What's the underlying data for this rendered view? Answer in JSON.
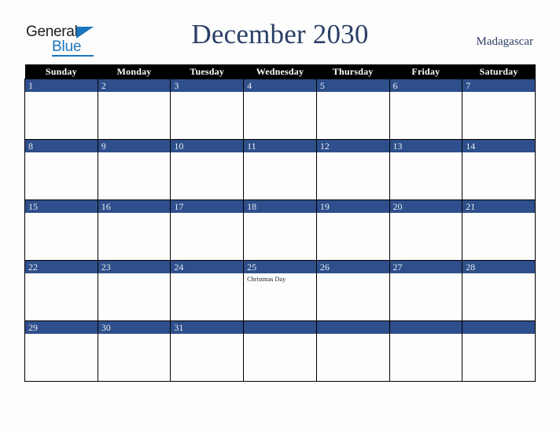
{
  "brand": {
    "name_part1": "General",
    "name_part2": "Blue",
    "color_dark": "#1c1c1c",
    "color_blue": "#1b75bc"
  },
  "header": {
    "title": "December 2030",
    "country": "Madagascar",
    "title_color": "#2c3e66"
  },
  "calendar": {
    "weekday_headers": [
      "Sunday",
      "Monday",
      "Tuesday",
      "Wednesday",
      "Thursday",
      "Friday",
      "Saturday"
    ],
    "header_bg": "#000000",
    "daybar_bg": "#2e4f8b",
    "cell_bg": "#fdfdfd",
    "weeks": [
      [
        {
          "date": "1",
          "events": []
        },
        {
          "date": "2",
          "events": []
        },
        {
          "date": "3",
          "events": []
        },
        {
          "date": "4",
          "events": []
        },
        {
          "date": "5",
          "events": []
        },
        {
          "date": "6",
          "events": []
        },
        {
          "date": "7",
          "events": []
        }
      ],
      [
        {
          "date": "8",
          "events": []
        },
        {
          "date": "9",
          "events": []
        },
        {
          "date": "10",
          "events": []
        },
        {
          "date": "11",
          "events": []
        },
        {
          "date": "12",
          "events": []
        },
        {
          "date": "13",
          "events": []
        },
        {
          "date": "14",
          "events": []
        }
      ],
      [
        {
          "date": "15",
          "events": []
        },
        {
          "date": "16",
          "events": []
        },
        {
          "date": "17",
          "events": []
        },
        {
          "date": "18",
          "events": []
        },
        {
          "date": "19",
          "events": []
        },
        {
          "date": "20",
          "events": []
        },
        {
          "date": "21",
          "events": []
        }
      ],
      [
        {
          "date": "22",
          "events": []
        },
        {
          "date": "23",
          "events": []
        },
        {
          "date": "24",
          "events": []
        },
        {
          "date": "25",
          "events": [
            "Christmas Day"
          ]
        },
        {
          "date": "26",
          "events": []
        },
        {
          "date": "27",
          "events": []
        },
        {
          "date": "28",
          "events": []
        }
      ],
      [
        {
          "date": "29",
          "events": []
        },
        {
          "date": "30",
          "events": []
        },
        {
          "date": "31",
          "events": []
        },
        {
          "date": "",
          "events": []
        },
        {
          "date": "",
          "events": []
        },
        {
          "date": "",
          "events": []
        },
        {
          "date": "",
          "events": []
        }
      ]
    ]
  }
}
